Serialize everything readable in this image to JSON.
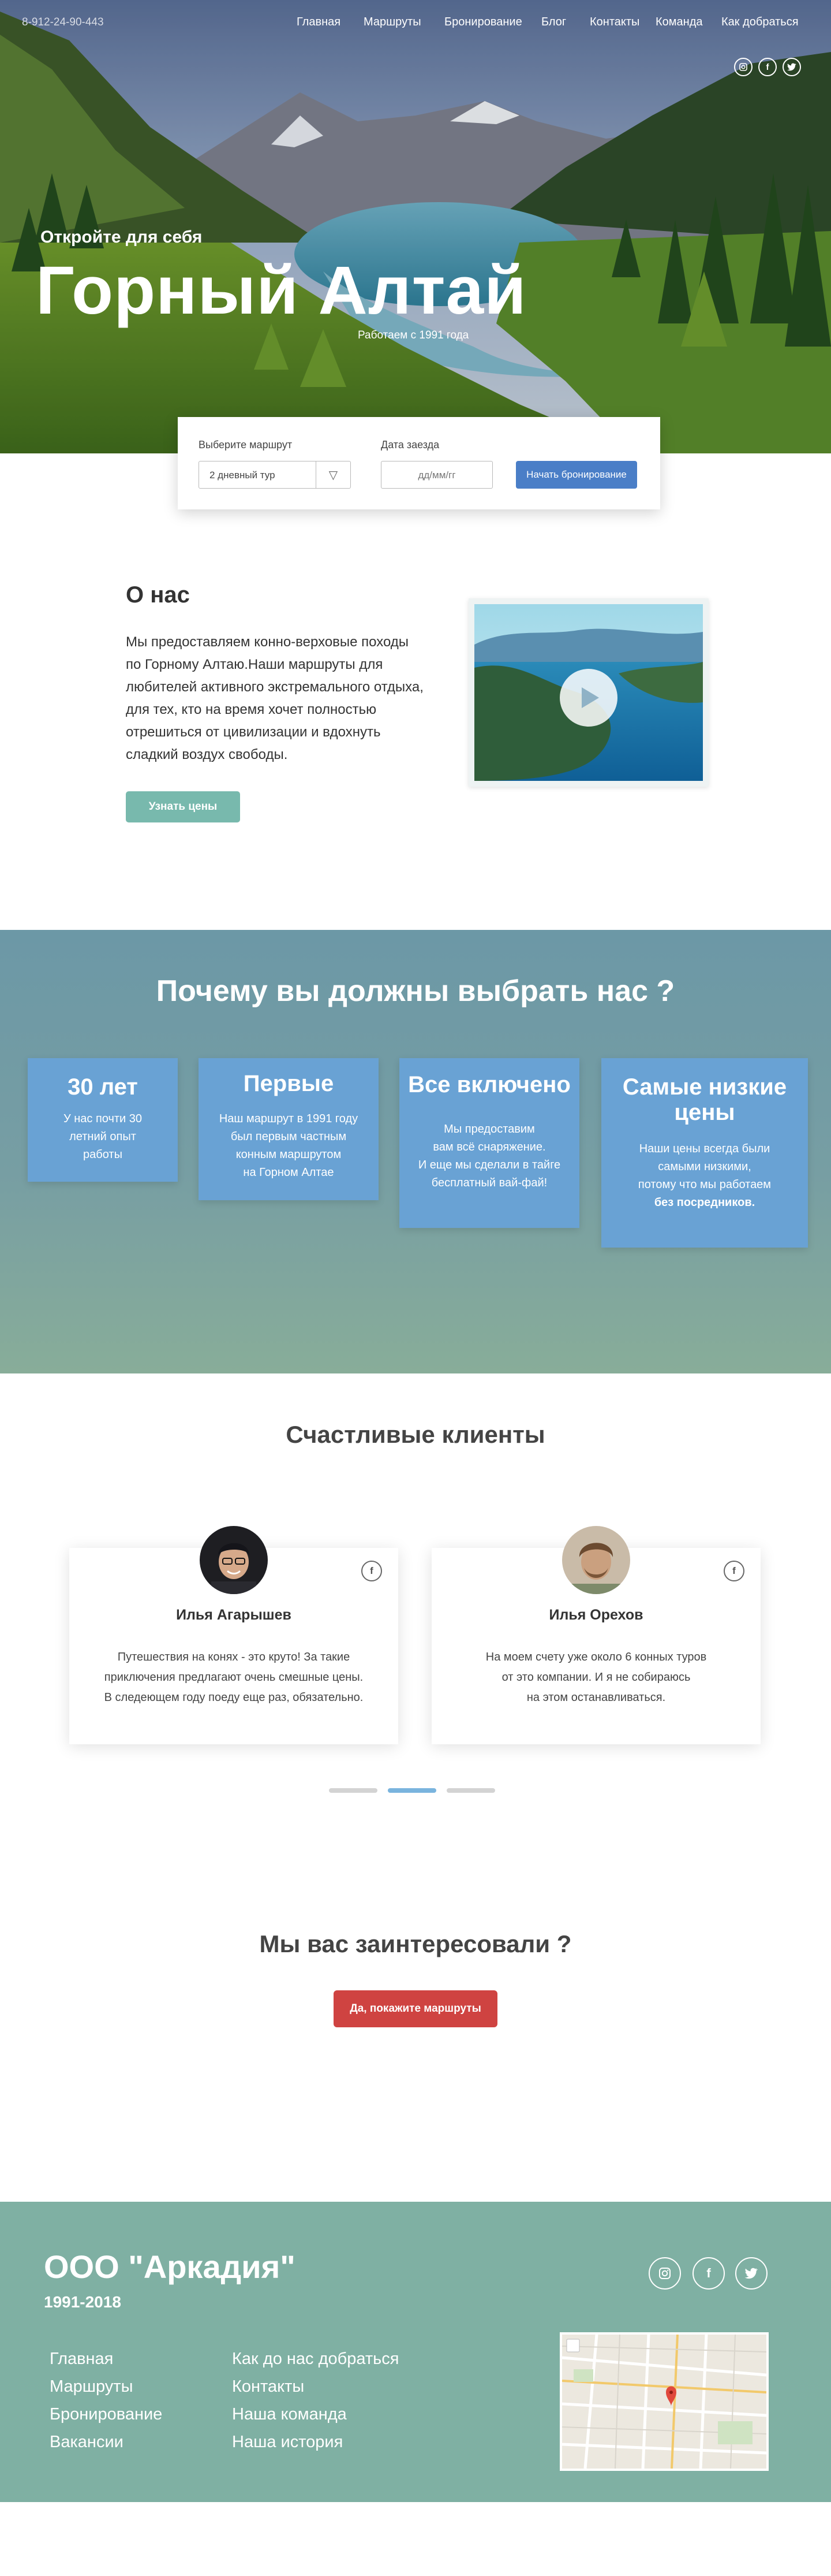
{
  "header": {
    "phone": "8-912-24-90-443",
    "nav": [
      "Главная",
      "Маршруты",
      "Бронирование",
      "Блог",
      "Контакты",
      "Команда",
      "Как добраться"
    ],
    "socials": [
      "instagram-icon",
      "facebook-icon",
      "twitter-icon"
    ]
  },
  "hero": {
    "subtitle": "Откройте для себя",
    "title": "Горный Алтай",
    "since": "Работаем с 1991 года"
  },
  "booking": {
    "route_label": "Выберите маршрут",
    "route_value": "2 дневный тур",
    "date_label": "Дата заезда",
    "date_placeholder": "дд/мм/гг",
    "submit_label": "Начать бронирование"
  },
  "about": {
    "title": "О нас",
    "text": "Мы предоставляем конно-верховые походы по  Горному Алтаю.Наши маршруты для любителей активного экстремального отдыха, для тех, кто на время хочет полностью отрешиться от цивилизации и вдохнуть сладкий воздух свободы.",
    "button_label": "Узнать цены"
  },
  "why": {
    "title": "Почему вы должны выбрать нас ?",
    "cards": [
      {
        "heading": "30 лет",
        "text_lines": [
          "У нас  почти 30",
          "летний опыт",
          "работы"
        ]
      },
      {
        "heading": "Первые",
        "text_lines": [
          "Наш маршрут в 1991 году",
          "был первым частным",
          "конным маршрутом",
          "на Горном Алтае"
        ]
      },
      {
        "heading": "Все включено",
        "text_lines": [
          "Мы предоставим",
          "вам всё снаряжение.",
          "И еще мы сделали в тайге",
          "бесплатный вай-фай!"
        ]
      },
      {
        "heading": "Самые низкие цены",
        "text_lines": [
          "Наши цены всегда были",
          "самыми низкими,",
          "потому что мы работаем"
        ],
        "text_bold": "без посредников."
      }
    ]
  },
  "clients": {
    "title": "Счастливые клиенты",
    "items": [
      {
        "name": "Илья Агарышев",
        "quote_lines": [
          "Путешествия на конях - это круто! За такие",
          "приключения предлагают очень смешные цены.",
          "В следеющем году поеду еще раз, обязательно."
        ]
      },
      {
        "name": "Илья Орехов",
        "quote_lines": [
          "На моем счету уже около 6 конных туров",
          "от это компании. И я не собираюсь",
          "на этом останавливаться."
        ]
      }
    ],
    "slider_active": 2,
    "slider_total": 3
  },
  "cta": {
    "title": "Мы вас заинтересовали ?",
    "button_label": "Да, покажите маршруты"
  },
  "footer": {
    "company": "ООО \"Аркадия\"",
    "years": "1991-2018",
    "links_col1": [
      "Главная",
      "Маршруты",
      "Бронирование",
      "Вакансии"
    ],
    "links_col2": [
      "Как до нас добраться",
      "Контакты",
      "Наша команда",
      "Наша история"
    ],
    "socials": [
      "instagram-icon",
      "facebook-icon",
      "twitter-icon"
    ]
  },
  "colors": {
    "accent_blue": "#4a7ec7",
    "card_blue": "#69a2d4",
    "teal": "#78b9ad",
    "cta_red": "#cf4341",
    "footer": "#7fb0a3"
  }
}
